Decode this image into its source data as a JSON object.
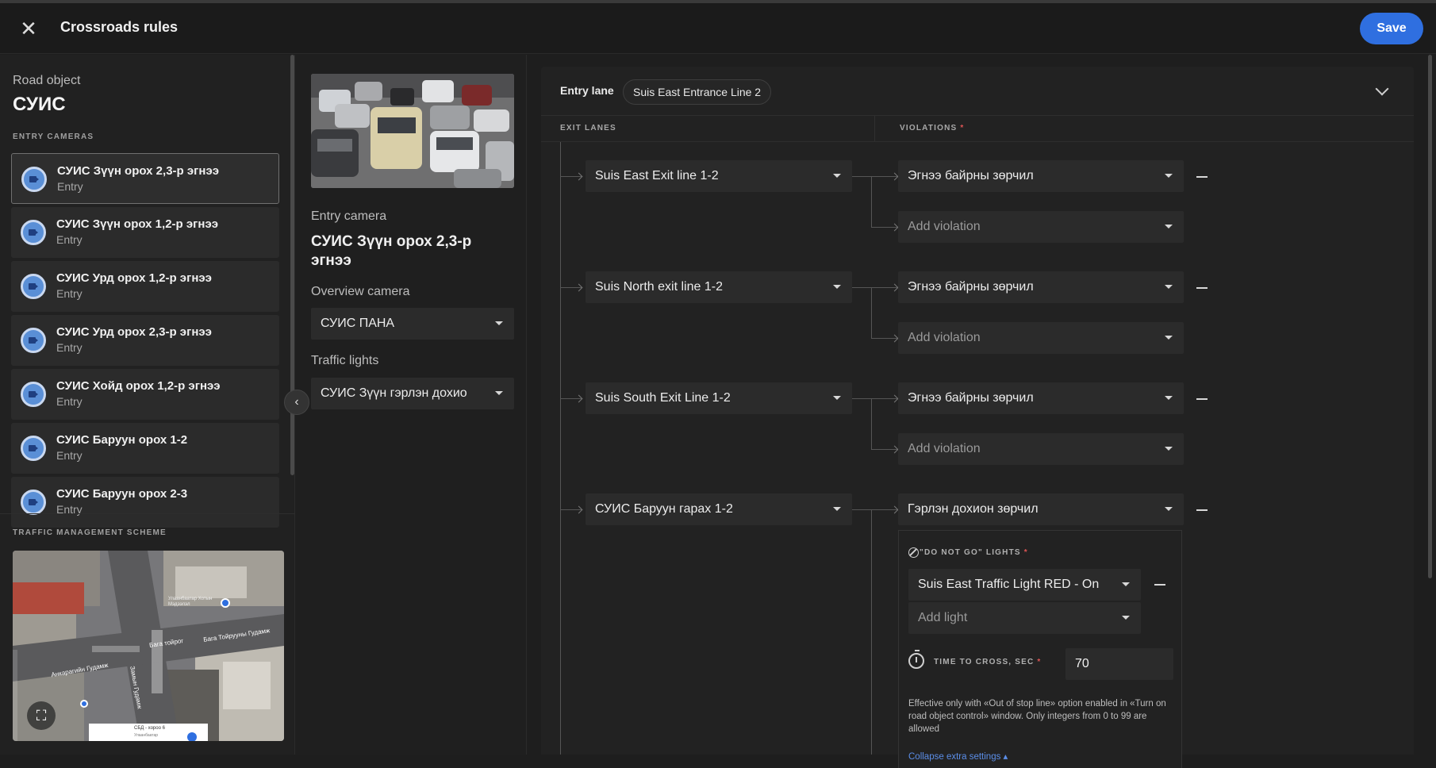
{
  "header": {
    "title": "Crossroads rules",
    "save_label": "Save"
  },
  "sidebar": {
    "road_object_label": "Road object",
    "road_object_name": "СУИС",
    "entry_cameras_label": "ENTRY CAMERAS",
    "cameras": [
      {
        "name": "СУИС Зүүн орох 2,3-р эгнээ",
        "type": "Entry"
      },
      {
        "name": "СУИС Зүүн орох 1,2-р эгнээ",
        "type": "Entry"
      },
      {
        "name": "СУИС Урд орох 1,2-р эгнээ",
        "type": "Entry"
      },
      {
        "name": "СУИС Урд орох 2,3-р эгнээ",
        "type": "Entry"
      },
      {
        "name": "СУИС Хойд орох 1,2-р эгнээ",
        "type": "Entry"
      },
      {
        "name": "СУИС Баруун орох 1-2",
        "type": "Entry"
      },
      {
        "name": "СУИС Баруун орох 2-3",
        "type": "Entry"
      }
    ],
    "traffic_scheme_label": "TRAFFIC MANAGEMENT SCHEME",
    "map_labels": {
      "street1": "Бага тойрог",
      "street2": "Бага Тойрууны Гудамж",
      "street3": "Анкарагийн Гудамж",
      "street4": "Замын Гудамж",
      "poi": "Улаанбаатар Хотын Мэдээлэл",
      "card_title": "СБД - хороо 6",
      "card_sub": "Улаанбаатар"
    }
  },
  "middle": {
    "entry_camera_label": "Entry camera",
    "entry_camera_name": "СУИС Зүүн орох 2,3-р эгнээ",
    "overview_camera_label": "Overview camera",
    "overview_camera_value": "СУИС ПАНА",
    "traffic_lights_label": "Traffic lights",
    "traffic_lights_value": "СУИС Зүүн гэрлэн дохио"
  },
  "rules": {
    "entry_lane_label": "Entry lane",
    "entry_lane_value": "Suis East Entrance Line 2",
    "exit_lanes_header": "EXIT LANES",
    "violations_header": "VIOLATIONS",
    "required_mark": "*",
    "exits": [
      {
        "lane": "Suis East Exit line 1-2",
        "violation": "Эгнээ байрны зөрчил",
        "add_violation": "Add violation"
      },
      {
        "lane": "Suis North exit line 1-2",
        "violation": "Эгнээ байрны зөрчил",
        "add_violation": "Add violation"
      },
      {
        "lane": "Suis South Exit Line 1-2",
        "violation": "Эгнээ байрны зөрчил",
        "add_violation": "Add violation"
      },
      {
        "lane": "СУИС Баруун гарах 1-2",
        "violation": "Гэрлэн дохион зөрчил"
      }
    ],
    "extra": {
      "dng_label": "\"DO NOT GO\" LIGHTS",
      "light_value": "Suis East Traffic Light RED - On",
      "add_light": "Add light",
      "ttc_label": "TIME TO CROSS, SEC",
      "ttc_value": "70",
      "note": "Effective only with «Out of stop line» option enabled in «Turn on road object control» window. Only integers from 0 to 99 are allowed",
      "collapse_link": "Collapse extra settings ▴"
    }
  }
}
